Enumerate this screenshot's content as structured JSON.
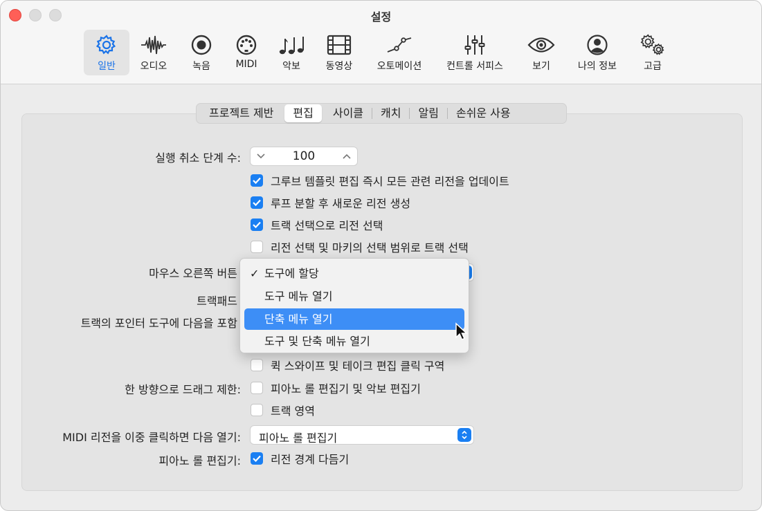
{
  "window": {
    "title": "설정"
  },
  "toolbar": {
    "items": [
      {
        "label": "일반",
        "icon": "gear-icon",
        "active": true
      },
      {
        "label": "오디오",
        "icon": "waveform-icon"
      },
      {
        "label": "녹음",
        "icon": "record-icon"
      },
      {
        "label": "MIDI",
        "icon": "midi-port-icon"
      },
      {
        "label": "악보",
        "icon": "music-notes-icon"
      },
      {
        "label": "동영상",
        "icon": "film-icon"
      },
      {
        "label": "오토메이션",
        "icon": "automation-curve-icon"
      },
      {
        "label": "컨트롤 서피스",
        "icon": "sliders-icon"
      },
      {
        "label": "보기",
        "icon": "eye-icon"
      },
      {
        "label": "나의 정보",
        "icon": "person-icon"
      },
      {
        "label": "고급",
        "icon": "gears-icon"
      }
    ]
  },
  "tabs": [
    {
      "label": "프로젝트 제반"
    },
    {
      "label": "편집",
      "selected": true
    },
    {
      "label": "사이클"
    },
    {
      "label": "캐치"
    },
    {
      "label": "알림"
    },
    {
      "label": "손쉬운 사용"
    }
  ],
  "undo": {
    "label": "실행 취소 단계 수:",
    "value": "100"
  },
  "checkboxes": {
    "groove": {
      "label": "그루브 템플릿 편집 즉시 모든 관련 리전을 업데이트",
      "checked": true
    },
    "loop": {
      "label": "루프 분할 후 새로운 리전 생성",
      "checked": true
    },
    "track_select": {
      "label": "트랙 선택으로 리전 선택",
      "checked": true
    },
    "marquee": {
      "label": "리전 선택 및 마키의 선택 범위로 트랙 선택",
      "checked": false
    },
    "quick_swipe": {
      "label": "퀵 스와이프 및 테이크 편집 클릭 구역",
      "checked": false
    },
    "piano_score": {
      "label": "피아노 롤 편집기 및 악보 편집기",
      "checked": false
    },
    "track_area": {
      "label": "트랙 영역",
      "checked": false
    },
    "region_borders": {
      "label": "리전 경계 다듬기",
      "checked": true
    }
  },
  "labels": {
    "right_mouse": "마우스 오른쪽 버튼",
    "trackpad": "트랙패드",
    "pointer_tool": "트랙의 포인터 도구에 다음을 포함",
    "drag_limit": "한 방향으로 드래그 제한:",
    "midi_double": "MIDI 리전을 이중 클릭하면 다음 열기:",
    "piano_roll": "피아노 롤 편집기:"
  },
  "midi_select": {
    "value": "피아노 롤 편집기"
  },
  "popup_menu": {
    "items": [
      {
        "label": "도구에 할당",
        "checked": true
      },
      {
        "label": "도구 메뉴 열기"
      },
      {
        "label": "단축 메뉴 열기",
        "highlighted": true
      },
      {
        "label": "도구 및 단축 메뉴 열기"
      }
    ]
  },
  "colors": {
    "accent": "#1a7ff2",
    "highlight": "#3d8ef6",
    "close": "#ff5f57"
  }
}
